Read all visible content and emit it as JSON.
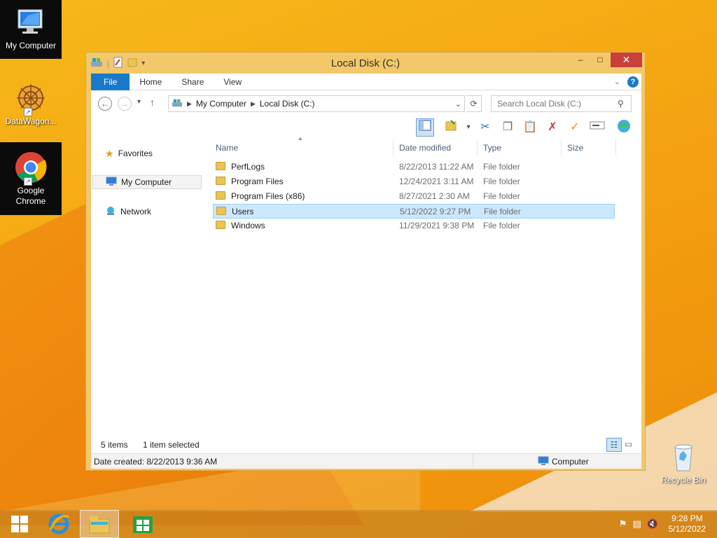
{
  "desktop": {
    "icons": [
      {
        "label": "My Computer"
      },
      {
        "label": "DataWagon..."
      },
      {
        "label": "Google Chrome"
      },
      {
        "label": "Recycle Bin"
      }
    ]
  },
  "window": {
    "title": "Local Disk (C:)",
    "controls": {
      "minimize": "–",
      "maximize": "□",
      "close": "✕"
    },
    "ribbon_tabs": [
      "File",
      "Home",
      "Share",
      "View"
    ],
    "address": {
      "back": "←",
      "forward": "→",
      "recent": "▾",
      "up": "↑",
      "crumbs": [
        "My Computer",
        "Local Disk (C:)"
      ],
      "refresh": "⟳",
      "search_placeholder": "Search Local Disk (C:)"
    },
    "nav": [
      {
        "label": "Favorites",
        "icon": "star-icon"
      },
      {
        "label": "My Computer",
        "icon": "computer-icon"
      },
      {
        "label": "Network",
        "icon": "network-icon"
      }
    ],
    "columns": [
      "Name",
      "Date modified",
      "Type",
      "Size"
    ],
    "files": [
      {
        "name": "PerfLogs",
        "date": "8/22/2013 11:22 AM",
        "type": "File folder",
        "size": ""
      },
      {
        "name": "Program Files",
        "date": "12/24/2021 3:11 AM",
        "type": "File folder",
        "size": ""
      },
      {
        "name": "Program Files (x86)",
        "date": "8/27/2021 2:30 AM",
        "type": "File folder",
        "size": ""
      },
      {
        "name": "Users",
        "date": "5/12/2022 9:27 PM",
        "type": "File folder",
        "size": ""
      },
      {
        "name": "Windows",
        "date": "11/29/2021 9:38 PM",
        "type": "File folder",
        "size": ""
      }
    ],
    "selected_index": 3,
    "status": {
      "items": "5 items",
      "selected": "1 item selected"
    },
    "details": {
      "created": "Date created: 8/22/2013 9:36 AM",
      "location": "Computer"
    }
  },
  "taskbar": {
    "time": "9:28 PM",
    "date": "5/12/2022"
  },
  "colors": {
    "accent": "#1979ca",
    "selection": "#cce8ff",
    "window_frame": "#f2c86a"
  }
}
